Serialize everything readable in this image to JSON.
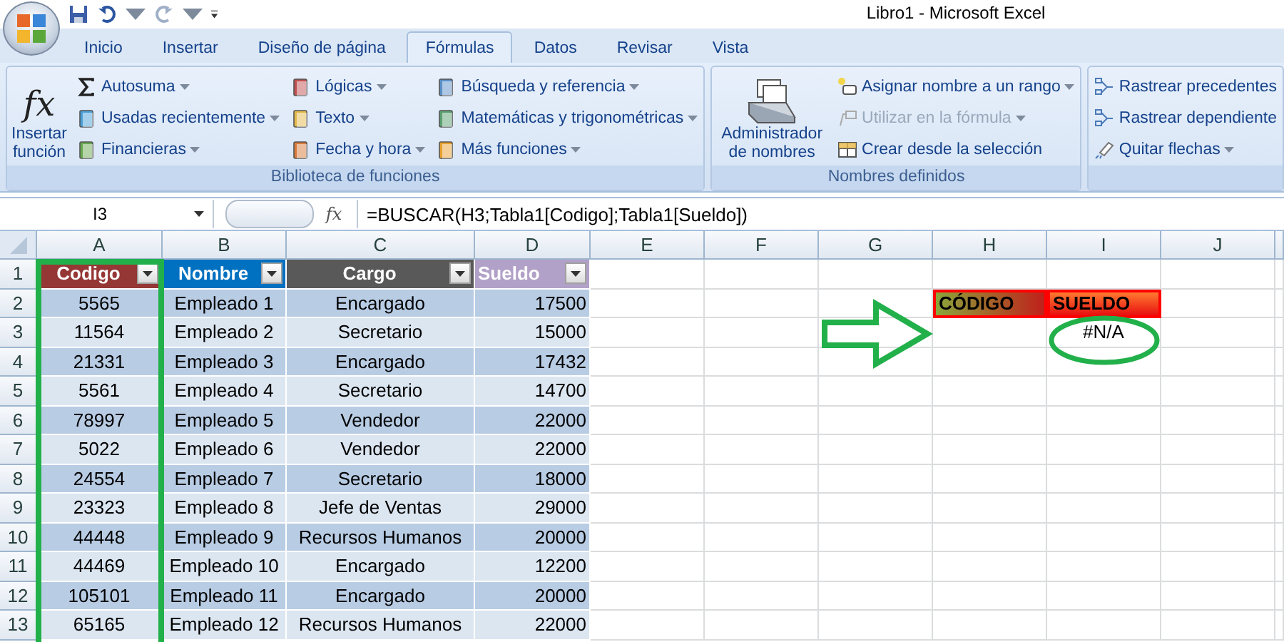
{
  "window": {
    "title": "Libro1 - Microsoft Excel"
  },
  "tabs": [
    {
      "label": "Inicio",
      "selected": false
    },
    {
      "label": "Insertar",
      "selected": false
    },
    {
      "label": "Diseño de página",
      "selected": false
    },
    {
      "label": "Fórmulas",
      "selected": true
    },
    {
      "label": "Datos",
      "selected": false
    },
    {
      "label": "Revisar",
      "selected": false
    },
    {
      "label": "Vista",
      "selected": false
    }
  ],
  "ribbon": {
    "groups": [
      {
        "label": "Biblioteca de funciones",
        "big_button": {
          "glyph": "fx",
          "label": "Insertar función"
        },
        "columns": [
          [
            {
              "label": "Autosuma",
              "menu": true,
              "disabled": false
            },
            {
              "label": "Usadas recientemente",
              "menu": true,
              "disabled": false
            },
            {
              "label": "Financieras",
              "menu": true,
              "disabled": false
            }
          ],
          [
            {
              "label": "Lógicas",
              "menu": true,
              "disabled": false
            },
            {
              "label": "Texto",
              "menu": true,
              "disabled": false
            },
            {
              "label": "Fecha y hora",
              "menu": true,
              "disabled": false
            }
          ],
          [
            {
              "label": "Búsqueda y referencia",
              "menu": true,
              "disabled": false
            },
            {
              "label": "Matemáticas y trigonométricas",
              "menu": true,
              "disabled": false
            },
            {
              "label": "Más funciones",
              "menu": true,
              "disabled": false
            }
          ]
        ]
      },
      {
        "label": "Nombres definidos",
        "big_button": {
          "label": "Administrador de nombres"
        },
        "columns": [
          [
            {
              "label": "Asignar nombre a un rango",
              "menu": true,
              "disabled": false
            },
            {
              "label": "Utilizar en la fórmula",
              "menu": true,
              "disabled": true
            },
            {
              "label": "Crear desde la selección",
              "menu": false,
              "disabled": false
            }
          ]
        ]
      },
      {
        "columns": [
          [
            {
              "label": "Rastrear precedentes",
              "menu": false,
              "disabled": false
            },
            {
              "label": "Rastrear dependiente",
              "menu": false,
              "disabled": false
            },
            {
              "label": "Quitar flechas",
              "menu": true,
              "disabled": false
            }
          ]
        ]
      }
    ]
  },
  "formula_bar": {
    "name_box": "I3",
    "glyph": "fx",
    "formula": "=BUSCAR(H3;Tabla1[Codigo];Tabla1[Sueldo])"
  },
  "sheet": {
    "columns": [
      "A",
      "B",
      "C",
      "D",
      "E",
      "F",
      "G",
      "H",
      "I",
      "J"
    ],
    "row_numbers": [
      "1",
      "2",
      "3",
      "4",
      "5",
      "6",
      "7",
      "8",
      "9",
      "10",
      "11",
      "12",
      "13"
    ],
    "table": {
      "headers": [
        {
          "label": "Codigo",
          "color": "#953735"
        },
        {
          "label": "Nombre",
          "color": "#0070c0"
        },
        {
          "label": "Cargo",
          "color": "#595959"
        },
        {
          "label": "Sueldo",
          "color": "#b1a0c7"
        }
      ],
      "rows": [
        [
          "5565",
          "Empleado 1",
          "Encargado",
          "17500"
        ],
        [
          "11564",
          "Empleado 2",
          "Secretario",
          "15000"
        ],
        [
          "21331",
          "Empleado 3",
          "Encargado",
          "17432"
        ],
        [
          "5561",
          "Empleado 4",
          "Secretario",
          "14700"
        ],
        [
          "78997",
          "Empleado 5",
          "Vendedor",
          "22000"
        ],
        [
          "5022",
          "Empleado 6",
          "Vendedor",
          "22000"
        ],
        [
          "24554",
          "Empleado 7",
          "Secretario",
          "18000"
        ],
        [
          "23323",
          "Empleado 8",
          "Jefe de Ventas",
          "29000"
        ],
        [
          "44448",
          "Empleado 9",
          "Recursos Humanos",
          "20000"
        ],
        [
          "44469",
          "Empleado 10",
          "Encargado",
          "12200"
        ],
        [
          "105101",
          "Empleado 11",
          "Encargado",
          "20000"
        ],
        [
          "65165",
          "Empleado 12",
          "Recursos Humanos",
          "22000"
        ]
      ]
    },
    "lookup": {
      "headers": [
        "CÓDIGO",
        "SUELDO"
      ],
      "result": "#N/A"
    }
  }
}
